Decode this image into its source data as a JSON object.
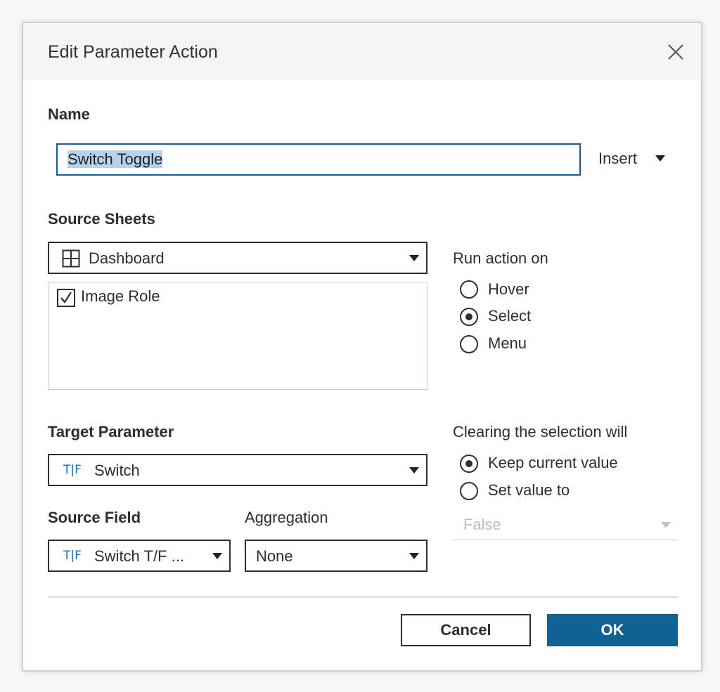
{
  "dialog": {
    "title": "Edit Parameter Action"
  },
  "name_section": {
    "label": "Name",
    "value": "Switch Toggle",
    "insert_label": "Insert"
  },
  "source_sheets": {
    "label": "Source Sheets",
    "selected_sheet": "Dashboard",
    "sheet_icon": "dashboard-grid-icon",
    "items": [
      {
        "label": "Image Role",
        "checked": true
      }
    ]
  },
  "run_action": {
    "label": "Run action on",
    "options": [
      {
        "label": "Hover",
        "selected": false
      },
      {
        "label": "Select",
        "selected": true
      },
      {
        "label": "Menu",
        "selected": false
      }
    ]
  },
  "target_parameter": {
    "label": "Target Parameter",
    "type_icon": "T|F",
    "value": "Switch"
  },
  "source_field": {
    "label": "Source Field",
    "type_icon": "T|F",
    "value": "Switch T/F ..."
  },
  "aggregation": {
    "label": "Aggregation",
    "value": "None"
  },
  "clearing": {
    "label": "Clearing the selection will",
    "options": [
      {
        "label": "Keep current value",
        "selected": true
      },
      {
        "label": "Set value to",
        "selected": false
      }
    ],
    "set_value": "False"
  },
  "buttons": {
    "cancel": "Cancel",
    "ok": "OK"
  },
  "colors": {
    "accent": "#0f6291",
    "focus_border": "#1f5a8c",
    "selection": "#b9d2ec",
    "type_icon": "#1f6fb0"
  }
}
